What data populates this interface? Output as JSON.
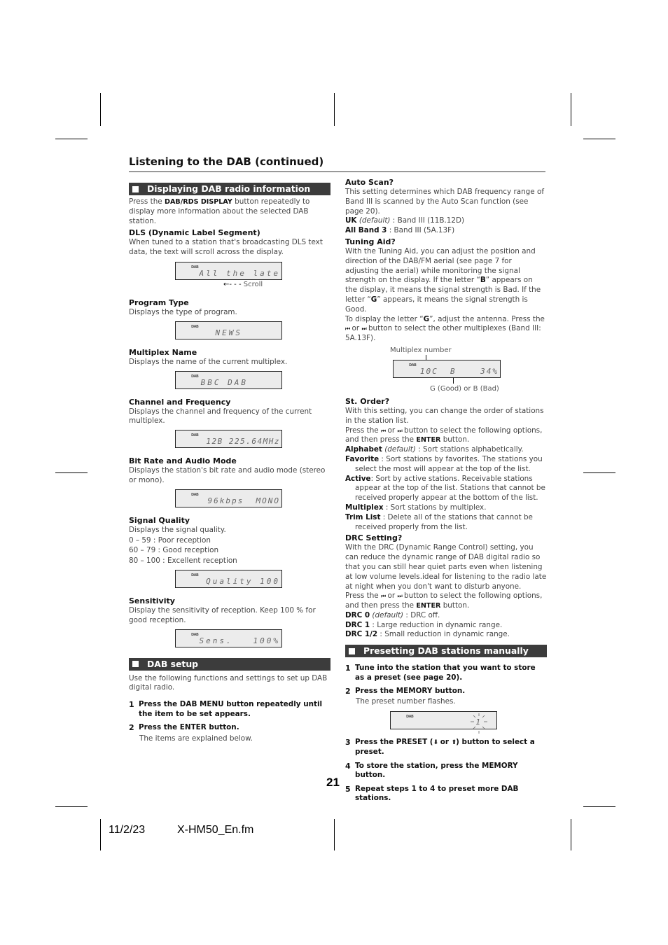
{
  "page": {
    "title": "Listening to the DAB (continued)",
    "page_number": "21",
    "footer_date": "11/2/23",
    "footer_file": "X-HM50_En.fm"
  },
  "left": {
    "section1": {
      "heading": "Displaying DAB radio information",
      "intro_pre": "Press the ",
      "intro_bold": "DAB/RDS DISPLAY",
      "intro_post": " button repeatedly to display more information about the selected DAB station.",
      "items": [
        {
          "title": "DLS (Dynamic Label Segment)",
          "desc": "When tuned to a station that's broadcasting DLS text data, the text will scroll across the display.",
          "lcd": "All the late",
          "note": "Scroll"
        },
        {
          "title": "Program Type",
          "desc": "Displays the type of program.",
          "lcd": "NEWS"
        },
        {
          "title": "Multiplex Name",
          "desc": "Displays the name of the current multiplex.",
          "lcd": "BBC DAB"
        },
        {
          "title": "Channel and Frequency",
          "desc": "Displays the channel and frequency of the current multiplex.",
          "lcd": "12B 225.64MHz"
        },
        {
          "title": "Bit Rate and Audio Mode",
          "desc": "Displays the station's bit rate and audio mode (stereo or mono).",
          "lcd": "96kbps  MONO"
        },
        {
          "title": "Signal Quality",
          "desc": "Displays the signal quality.",
          "ranges": [
            "0 – 59 : Poor reception",
            "60 – 79 : Good reception",
            "80 – 100 : Excellent reception"
          ],
          "lcd": "Quality 100"
        },
        {
          "title": "Sensitivity",
          "desc": "Display the sensitivity of reception. Keep 100 % for good reception.",
          "lcd": "Sens.   100%"
        }
      ],
      "lcd_badge": "DAB"
    },
    "section2": {
      "heading": "DAB setup",
      "intro": "Use the following functions and settings to set up DAB digital radio.",
      "steps": [
        {
          "n": "1",
          "text": "Press the DAB MENU button repeatedly until the item to be set appears."
        },
        {
          "n": "2",
          "text": "Press the ENTER button.",
          "note": "The items are explained below."
        }
      ]
    }
  },
  "right": {
    "auto_scan": {
      "title": "Auto Scan?",
      "desc": "This setting determines which DAB frequency range of Band III is scanned by the Auto Scan function (see page 20).",
      "opt1_bold": "UK",
      "opt1_italic": "(default)",
      "opt1_text": " : Band III (11B.12D)",
      "opt2_bold": "All Band 3",
      "opt2_text": " : Band III (5A.13F)"
    },
    "tuning_aid": {
      "title": "Tuning Aid?",
      "desc1": "With the Tuning Aid, you can adjust the position and direction of the DAB/FM aerial (see page 7 for adjusting the aerial) while monitoring the signal strength on the display. If the letter “",
      "b_letter": "B",
      "desc2": "” appears on the display, it means the signal strength is Bad. If the letter “",
      "g_letter": "G",
      "desc3": "” appears, it means the signal strength is Good.",
      "desc4_pre": "To display the letter “",
      "desc4_mid": "”, adjust the antenna. Press the ",
      "or": " or ",
      "desc4_post": " button to select the other multiplexes (Band III: 5A.13F).",
      "label_top": "Multiplex number",
      "lcd": "10C  B    34%",
      "label_bottom": "G (Good) or B (Bad)"
    },
    "st_order": {
      "title": "St. Order?",
      "desc": "With this setting, you can change the order of stations in the station list.",
      "press_pre": "Press the ",
      "or": " or ",
      "press_mid": " button to select the following options, and then press the ",
      "enter": "ENTER",
      "press_post": " button.",
      "options": [
        {
          "name": "Alphabet",
          "italic": "(default)",
          "text": " : Sort stations alphabetically."
        },
        {
          "name": "Favorite",
          "italic": "",
          "text": " : Sort stations by favorites. The stations you select the most will appear at the top of the list."
        },
        {
          "name": "Active",
          "italic": "",
          "text": ": Sort by active stations. Receivable stations appear at the top of the list. Stations that cannot be received properly appear at the bottom of the list."
        },
        {
          "name": "Multiplex",
          "italic": "",
          "text": " : Sort stations by multiplex."
        },
        {
          "name": "Trim List",
          "italic": "",
          "text": " : Delete all of the stations that cannot be received properly from the list."
        }
      ]
    },
    "drc": {
      "title": "DRC Setting?",
      "desc": "With the DRC (Dynamic Range Control) setting, you can reduce the dynamic range of DAB digital radio so that you can still hear quiet parts even when listening at low volume levels.ideal for listening to the radio late at night when you don't want to disturb anyone.",
      "press_pre": "Press the ",
      "or": " or ",
      "press_mid": " button to select the following options, and then press the ",
      "enter": "ENTER",
      "press_post": " button.",
      "options": [
        {
          "name": "DRC 0",
          "italic": "(default)",
          "text": " : DRC off."
        },
        {
          "name": "DRC 1",
          "italic": "",
          "text": " : Large reduction in dynamic range."
        },
        {
          "name": "DRC 1/2",
          "italic": "",
          "text": " : Small reduction in dynamic range."
        }
      ]
    },
    "presetting": {
      "heading": "Presetting DAB stations manually",
      "steps": [
        {
          "n": "1",
          "text": "Tune into the station that you want to store as a preset (see page 20)."
        },
        {
          "n": "2",
          "text": "Press the MEMORY button.",
          "note": "The preset number flashes."
        },
        {
          "n": "3",
          "text_pre": "Press the PRESET (",
          "or": " or ",
          "text_post": ") button to select a preset."
        },
        {
          "n": "4",
          "text": "To store the station, press the MEMORY button."
        },
        {
          "n": "5",
          "text": "Repeat steps 1 to 4 to preset more DAB stations."
        }
      ],
      "lcd_digit": "1"
    }
  },
  "icons": {
    "prev": "⏮",
    "next": "⏭",
    "down_arrow": "⬇",
    "up_arrow": "⬆",
    "scroll_arrow": "←- - -"
  }
}
